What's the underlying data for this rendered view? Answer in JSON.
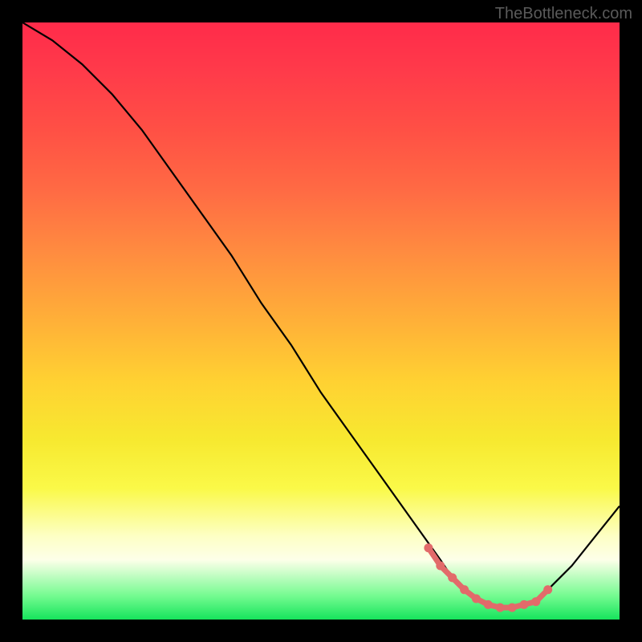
{
  "watermark": "TheBottleneck.com",
  "chart_data": {
    "type": "line",
    "title": "",
    "xlabel": "",
    "ylabel": "",
    "xlim": [
      0,
      100
    ],
    "ylim": [
      0,
      100
    ],
    "grid": false,
    "series": [
      {
        "name": "bottleneck-curve",
        "x": [
          0,
          5,
          10,
          15,
          20,
          25,
          30,
          35,
          40,
          45,
          50,
          55,
          60,
          65,
          70,
          72,
          74,
          76,
          78,
          80,
          82,
          84,
          86,
          88,
          92,
          96,
          100
        ],
        "values": [
          100,
          97,
          93,
          88,
          82,
          75,
          68,
          61,
          53,
          46,
          38,
          31,
          24,
          17,
          10,
          7,
          5,
          3.5,
          2.5,
          2,
          2,
          2.5,
          3,
          5,
          9,
          14,
          19
        ]
      }
    ],
    "markers": {
      "name": "optimal-zone-markers",
      "color": "#e26a6a",
      "x": [
        68,
        70,
        72,
        74,
        76,
        78,
        80,
        82,
        84,
        86,
        88
      ],
      "values": [
        12,
        9,
        7,
        5,
        3.5,
        2.5,
        2,
        2,
        2.5,
        3,
        5
      ]
    },
    "background_gradient": {
      "top_color": "#ff2b4a",
      "mid_color": "#ffd132",
      "bottom_color": "#16e45c"
    }
  }
}
